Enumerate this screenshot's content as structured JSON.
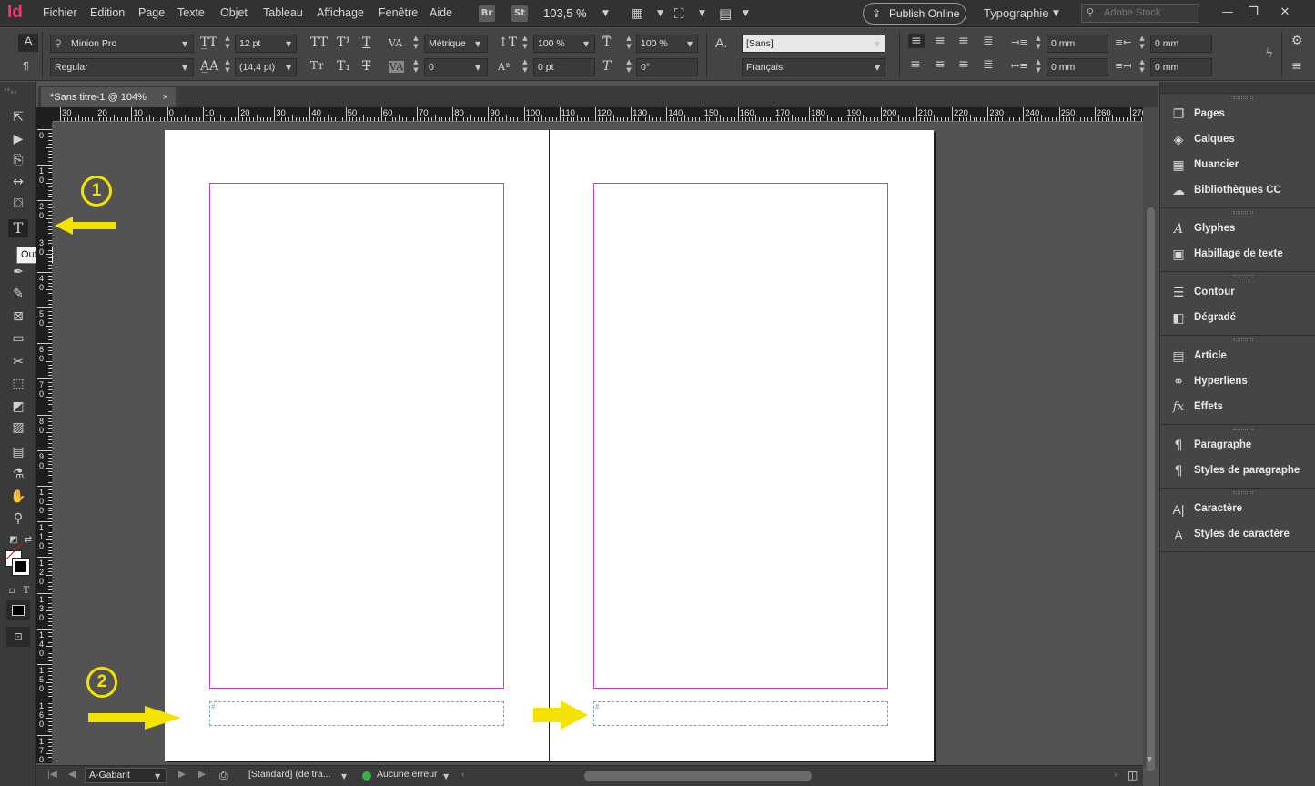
{
  "menubar": {
    "app_logo": "Id",
    "items": [
      "Fichier",
      "Edition",
      "Page",
      "Texte",
      "Objet",
      "Tableau",
      "Affichage",
      "Fenêtre",
      "Aide"
    ],
    "bridge": "Br",
    "stock": "St",
    "zoom": "103,5 %",
    "publish": "Publish Online",
    "workspace": "Typographie",
    "search_placeholder": "Adobe Stock"
  },
  "control": {
    "font_family": "Minion Pro",
    "font_style": "Regular",
    "font_size": "12 pt",
    "leading": "(14,4 pt)",
    "kerning": "Métrique",
    "tracking": "0",
    "vscale": "100 %",
    "baseline": "0 pt",
    "hscale": "100 %",
    "skew": "0°",
    "char_style": "[Sans]",
    "language": "Français",
    "left_indent": "0 mm",
    "right_indent": "0 mm",
    "first_indent": "0 mm",
    "last_indent": "0 mm"
  },
  "tab": {
    "title": "*Sans titre-1 @ 104%",
    "close": "×"
  },
  "tooltip": "Outil Texte (T)",
  "ruler": {
    "h_labels": [
      "30",
      "20",
      "10",
      "0",
      "10",
      "20",
      "30",
      "40",
      "50",
      "60",
      "70",
      "80",
      "90",
      "100",
      "110",
      "120",
      "130",
      "140",
      "150",
      "160",
      "170",
      "180",
      "190",
      "200",
      "210",
      "220",
      "230",
      "240",
      "250",
      "260",
      "270"
    ],
    "v_labels": [
      "0",
      "10",
      "20",
      "30",
      "40",
      "50",
      "60",
      "70",
      "80",
      "90",
      "100",
      "110",
      "120",
      "130",
      "140",
      "150",
      "160",
      "170"
    ]
  },
  "pages": {
    "left_number_marker": "#",
    "right_number_marker": "#"
  },
  "statusbar": {
    "master": "A-Gabarit",
    "profile": "[Standard] (de tra...",
    "preflight": "Aucune erreur"
  },
  "panels": [
    {
      "label": "Pages",
      "icon": "pages-icon"
    },
    {
      "label": "Calques",
      "icon": "layers-icon"
    },
    {
      "label": "Nuancier",
      "icon": "swatches-icon"
    },
    {
      "label": "Bibliothèques CC",
      "icon": "cc-libraries-icon"
    },
    {
      "label": "Glyphes",
      "icon": "glyphs-icon"
    },
    {
      "label": "Habillage de texte",
      "icon": "text-wrap-icon"
    },
    {
      "label": "Contour",
      "icon": "stroke-icon"
    },
    {
      "label": "Dégradé",
      "icon": "gradient-icon"
    },
    {
      "label": "Article",
      "icon": "article-icon"
    },
    {
      "label": "Hyperliens",
      "icon": "hyperlinks-icon"
    },
    {
      "label": "Effets",
      "icon": "effects-icon"
    },
    {
      "label": "Paragraphe",
      "icon": "paragraph-icon"
    },
    {
      "label": "Styles de paragraphe",
      "icon": "paragraph-styles-icon"
    },
    {
      "label": "Caractère",
      "icon": "character-icon"
    },
    {
      "label": "Styles de caractère",
      "icon": "character-styles-icon"
    }
  ],
  "annotations": {
    "one": "1",
    "two": "2"
  },
  "colors": {
    "accent_annotation": "#f4e300",
    "margin_guide": "#c93bc9",
    "frame_edge": "#6aa4d8",
    "app_logo": "#ff3366"
  }
}
